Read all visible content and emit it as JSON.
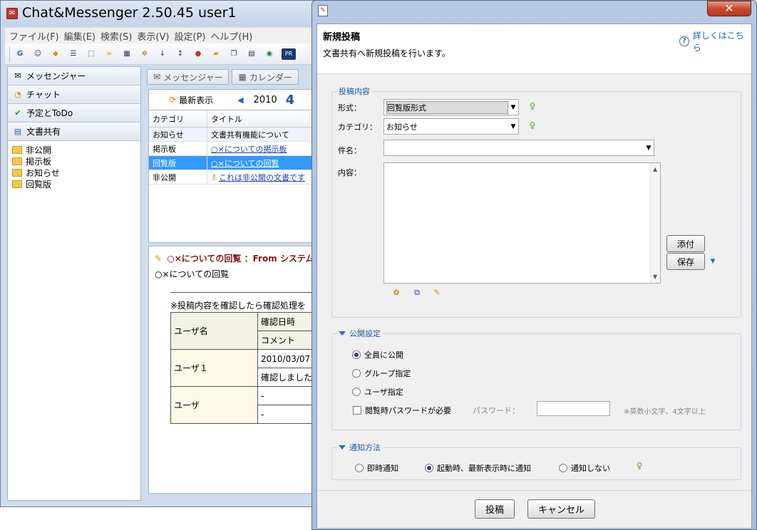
{
  "main_window": {
    "title": "Chat&Messenger 2.50.45 user1",
    "menu": [
      "ファイル(F)",
      "編集(E)",
      "検索(S)",
      "表示(V)",
      "設定(P)",
      "ヘルプ(H)"
    ],
    "nav": [
      "メッセンジャー",
      "チャット",
      "予定とToDo",
      "文書共有"
    ],
    "tree": [
      "非公開",
      "掲示板",
      "お知らせ",
      "回覧版"
    ],
    "tabs": [
      "メッセンジャー",
      "カレンダー"
    ],
    "refresh_label": "最新表示",
    "year": "2010",
    "month": "4",
    "table": {
      "headers": [
        "カテゴリ",
        "タイトル"
      ],
      "rows": [
        {
          "category": "お知らせ",
          "title": "文書共有機能について"
        },
        {
          "category": "掲示板",
          "title": "○×についての掲示板"
        },
        {
          "category": "回覧版",
          "title": "○×についての回覧"
        },
        {
          "category": "非公開",
          "title": "これは非公開の文書です"
        }
      ]
    },
    "preview": {
      "title": "○×についての回覧 ：From システム",
      "subject": "○×についての回覧",
      "note": "※投稿内容を確認したら確認処理を",
      "user_header": "ユーザ名",
      "date_header": "確認日時",
      "comment_header": "コメント",
      "user1": "ユーザ１",
      "user1_date": "2010/03/07",
      "user1_comment": "確認しました",
      "user2": "ユーザ",
      "user2_date": "-",
      "user2_comment": "-"
    }
  },
  "dialog": {
    "close_label": "✕",
    "heading": "新規投稿",
    "description": "文書共有へ新規投稿を行います。",
    "help_link": "詳しくはこちら",
    "section_content": "投稿内容",
    "format_label": "形式：",
    "format_value": "回覧版形式",
    "category_label": "カテゴリ：",
    "category_value": "お知らせ",
    "subject_label": "件名：",
    "subject_value": "",
    "content_label": "内容：",
    "attach_button": "添付",
    "save_button": "保存",
    "section_public": "公開設定",
    "public_options": [
      "全員に公開",
      "グループ指定",
      "ユーザ指定"
    ],
    "public_selected": 0,
    "password_checkbox": "閲覧時パスワードが必要",
    "password_label": "パスワード：",
    "password_hint": "※英数小文字、4文字以上",
    "section_notify": "通知方法",
    "notify_options": [
      "即時通知",
      "起動時、最新表示時に通知",
      "通知しない"
    ],
    "notify_selected": 1,
    "post_button": "投稿",
    "cancel_button": "キャンセル"
  },
  "colors": {
    "accent": "#1f5aa8",
    "selection": "#3399ff",
    "close_button": "#c4462c"
  }
}
